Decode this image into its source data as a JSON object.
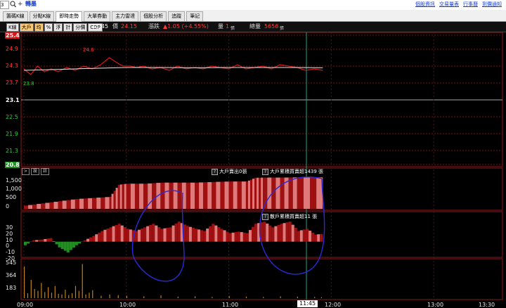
{
  "top": {
    "code_value": "3",
    "stock_name": "轉墨",
    "links": [
      "個股資訊",
      "交易量表",
      "行事曆",
      "到價通知"
    ]
  },
  "tabs": [
    {
      "label": "籌碼K線",
      "active": false
    },
    {
      "label": "分點K線",
      "active": false
    },
    {
      "label": "即時走勢",
      "active": true
    },
    {
      "label": "大單券動",
      "active": false
    },
    {
      "label": "主力雷達",
      "active": false
    },
    {
      "label": "個股分析",
      "active": false
    },
    {
      "label": "追蹤",
      "active": false
    },
    {
      "label": "筆記",
      "active": false
    }
  ],
  "toolbar": {
    "buttons": [
      {
        "label": "K線",
        "highlight": false
      },
      {
        "label": "大戶",
        "highlight": true
      },
      {
        "label": "均",
        "highlight": true
      },
      {
        "label": "%",
        "highlight": false
      },
      {
        "label": "浮",
        "highlight": false
      },
      {
        "label": "計",
        "highlight": false
      },
      {
        "label": "分價",
        "highlight": false
      },
      {
        "label": "CDP",
        "highlight": false
      }
    ],
    "time": "11:45",
    "price_label": "價",
    "price": "24.15",
    "change_label": "漲跌",
    "change": "▲1.05 (+4.55%)",
    "volume_label": "量",
    "volume": "1",
    "volume_unit": "張",
    "total_label": "總量",
    "total": "5656",
    "total_unit": "張"
  },
  "chart_data": [
    {
      "type": "line",
      "title": "",
      "y_ticks": [
        "25.4",
        "24.9",
        "24.3",
        "23.7",
        "23.1",
        "22.5",
        "21.9",
        "21.3",
        "20.8"
      ],
      "ylim": [
        20.8,
        25.4
      ],
      "reference_price": 23.1,
      "x_ticks": [
        "09:00",
        "10:00",
        "11:00",
        "12:00",
        "13:00",
        "13:30"
      ],
      "current_time_label": "11:45",
      "high_label": "24.6",
      "low_label": "23.8",
      "series": [
        {
          "color": "#d81818",
          "x_minutes": [
            0,
            4,
            8,
            12,
            16,
            20,
            25,
            30,
            35,
            40,
            45,
            50,
            55,
            58,
            62,
            66,
            70,
            75,
            80,
            85,
            90,
            95,
            100,
            105,
            110,
            115,
            120,
            125,
            130,
            135,
            140,
            145,
            150,
            155,
            160,
            165,
            170,
            175
          ],
          "values": [
            24.2,
            24.0,
            24.3,
            24.1,
            24.2,
            24.1,
            24.25,
            24.15,
            24.3,
            24.2,
            24.35,
            24.6,
            24.4,
            24.3,
            24.3,
            24.25,
            24.3,
            24.2,
            24.25,
            24.15,
            24.3,
            24.2,
            24.25,
            24.2,
            24.3,
            24.25,
            24.2,
            24.35,
            24.2,
            24.25,
            24.3,
            24.2,
            24.35,
            24.3,
            24.25,
            24.15,
            24.2,
            24.15
          ]
        },
        {
          "color": "#e8e8e8",
          "x_minutes": [
            0,
            20,
            40,
            60,
            80,
            100,
            120,
            140,
            160,
            175
          ],
          "values": [
            24.15,
            24.18,
            24.22,
            24.25,
            24.25,
            24.24,
            24.25,
            24.25,
            24.25,
            24.24
          ]
        }
      ]
    },
    {
      "type": "area",
      "y_ticks": [
        "1,500",
        "1,000",
        "500",
        "0"
      ],
      "ylim": [
        0,
        1800
      ],
      "label_sell": "大戶賣出0張",
      "label_net": "大戶累積買賣超1439 張",
      "x_minutes": [
        0,
        10,
        20,
        30,
        40,
        50,
        55,
        60,
        70,
        80,
        90,
        100,
        110,
        120,
        130,
        135,
        140,
        150,
        160,
        175
      ],
      "values": [
        150,
        250,
        350,
        450,
        500,
        550,
        1100,
        1150,
        1150,
        1200,
        1200,
        1200,
        1230,
        1250,
        1250,
        1420,
        1430,
        1430,
        1439,
        1439
      ]
    },
    {
      "type": "area",
      "y_ticks": [
        "30",
        "20",
        "10",
        "0",
        "-10",
        "-20"
      ],
      "ylim": [
        -20,
        40
      ],
      "label_net": "散戶累積買賣超11 張",
      "x_minutes": [
        0,
        5,
        10,
        15,
        20,
        25,
        30,
        35,
        40,
        45,
        50,
        55,
        60,
        65,
        70,
        75,
        80,
        85,
        90,
        95,
        100,
        105,
        110,
        115,
        120,
        125,
        130,
        135,
        140,
        145,
        150,
        155,
        160,
        165,
        170,
        175
      ],
      "values": [
        -5,
        2,
        3,
        5,
        -8,
        -15,
        -5,
        2,
        8,
        15,
        20,
        25,
        18,
        15,
        20,
        25,
        18,
        20,
        28,
        22,
        18,
        15,
        25,
        18,
        12,
        14,
        12,
        25,
        28,
        20,
        25,
        28,
        15,
        18,
        10,
        11
      ]
    },
    {
      "type": "bar",
      "y_ticks": [
        "545",
        "364",
        "183"
      ],
      "ylim": [
        0,
        600
      ],
      "x_minutes": [
        0,
        2,
        4,
        6,
        8,
        10,
        12,
        14,
        16,
        18,
        20,
        22,
        24,
        26,
        28,
        30,
        32,
        34,
        36,
        38,
        40,
        45,
        50,
        55,
        60,
        70,
        80,
        90,
        100,
        110,
        120,
        130,
        140,
        150,
        160,
        170,
        174
      ],
      "values": [
        520,
        80,
        300,
        150,
        120,
        250,
        100,
        180,
        90,
        200,
        70,
        60,
        140,
        50,
        80,
        200,
        120,
        560,
        60,
        90,
        130,
        40,
        60,
        50,
        40,
        30,
        45,
        25,
        30,
        20,
        35,
        25,
        20,
        30,
        25,
        20,
        15
      ]
    }
  ]
}
